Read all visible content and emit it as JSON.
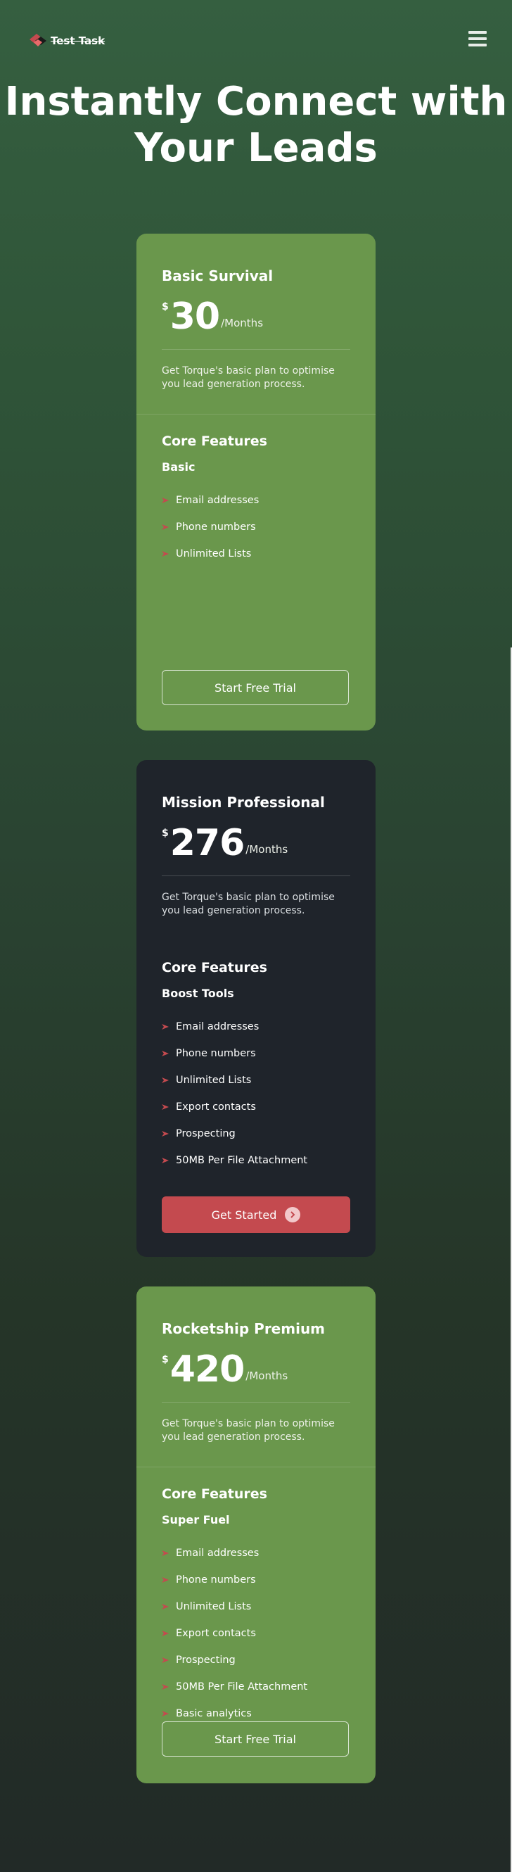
{
  "header": {
    "logo_text": "Test Task",
    "menu_icon": "hamburger-menu-icon"
  },
  "hero": {
    "title": "Instantly Connect with Your Leads"
  },
  "colors": {
    "green_card": "#6a974c",
    "dark_card": "#1f242b",
    "accent_red": "#c44a4f"
  },
  "plans": [
    {
      "name": "Basic Survival",
      "currency": "$",
      "price": "30",
      "period": "/Months",
      "description": "Get Torque's basic plan to optimise you lead generation process.",
      "features_heading": "Core Features",
      "tier": "Basic",
      "features": [
        "Email addresses",
        "Phone numbers",
        "Unlimited Lists"
      ],
      "cta": "Start Free Trial"
    },
    {
      "name": "Mission Professional",
      "currency": "$",
      "price": "276",
      "period": "/Months",
      "description": "Get Torque's basic plan to optimise you lead generation process.",
      "features_heading": "Core Features",
      "tier": "Boost Tools",
      "features": [
        "Email addresses",
        "Phone numbers",
        "Unlimited Lists",
        "Export contacts",
        "Prospecting",
        "50MB Per File Attachment"
      ],
      "cta": "Get Started"
    },
    {
      "name": "Rocketship Premium",
      "currency": "$",
      "price": "420",
      "period": "/Months",
      "description": "Get Torque's basic plan to optimise you lead generation process.",
      "features_heading": "Core Features",
      "tier": "Super Fuel",
      "features": [
        "Email addresses",
        "Phone numbers",
        "Unlimited Lists",
        "Export contacts",
        "Prospecting",
        "50MB Per File Attachment",
        "Basic analytics"
      ],
      "cta": "Start Free Trial"
    }
  ]
}
